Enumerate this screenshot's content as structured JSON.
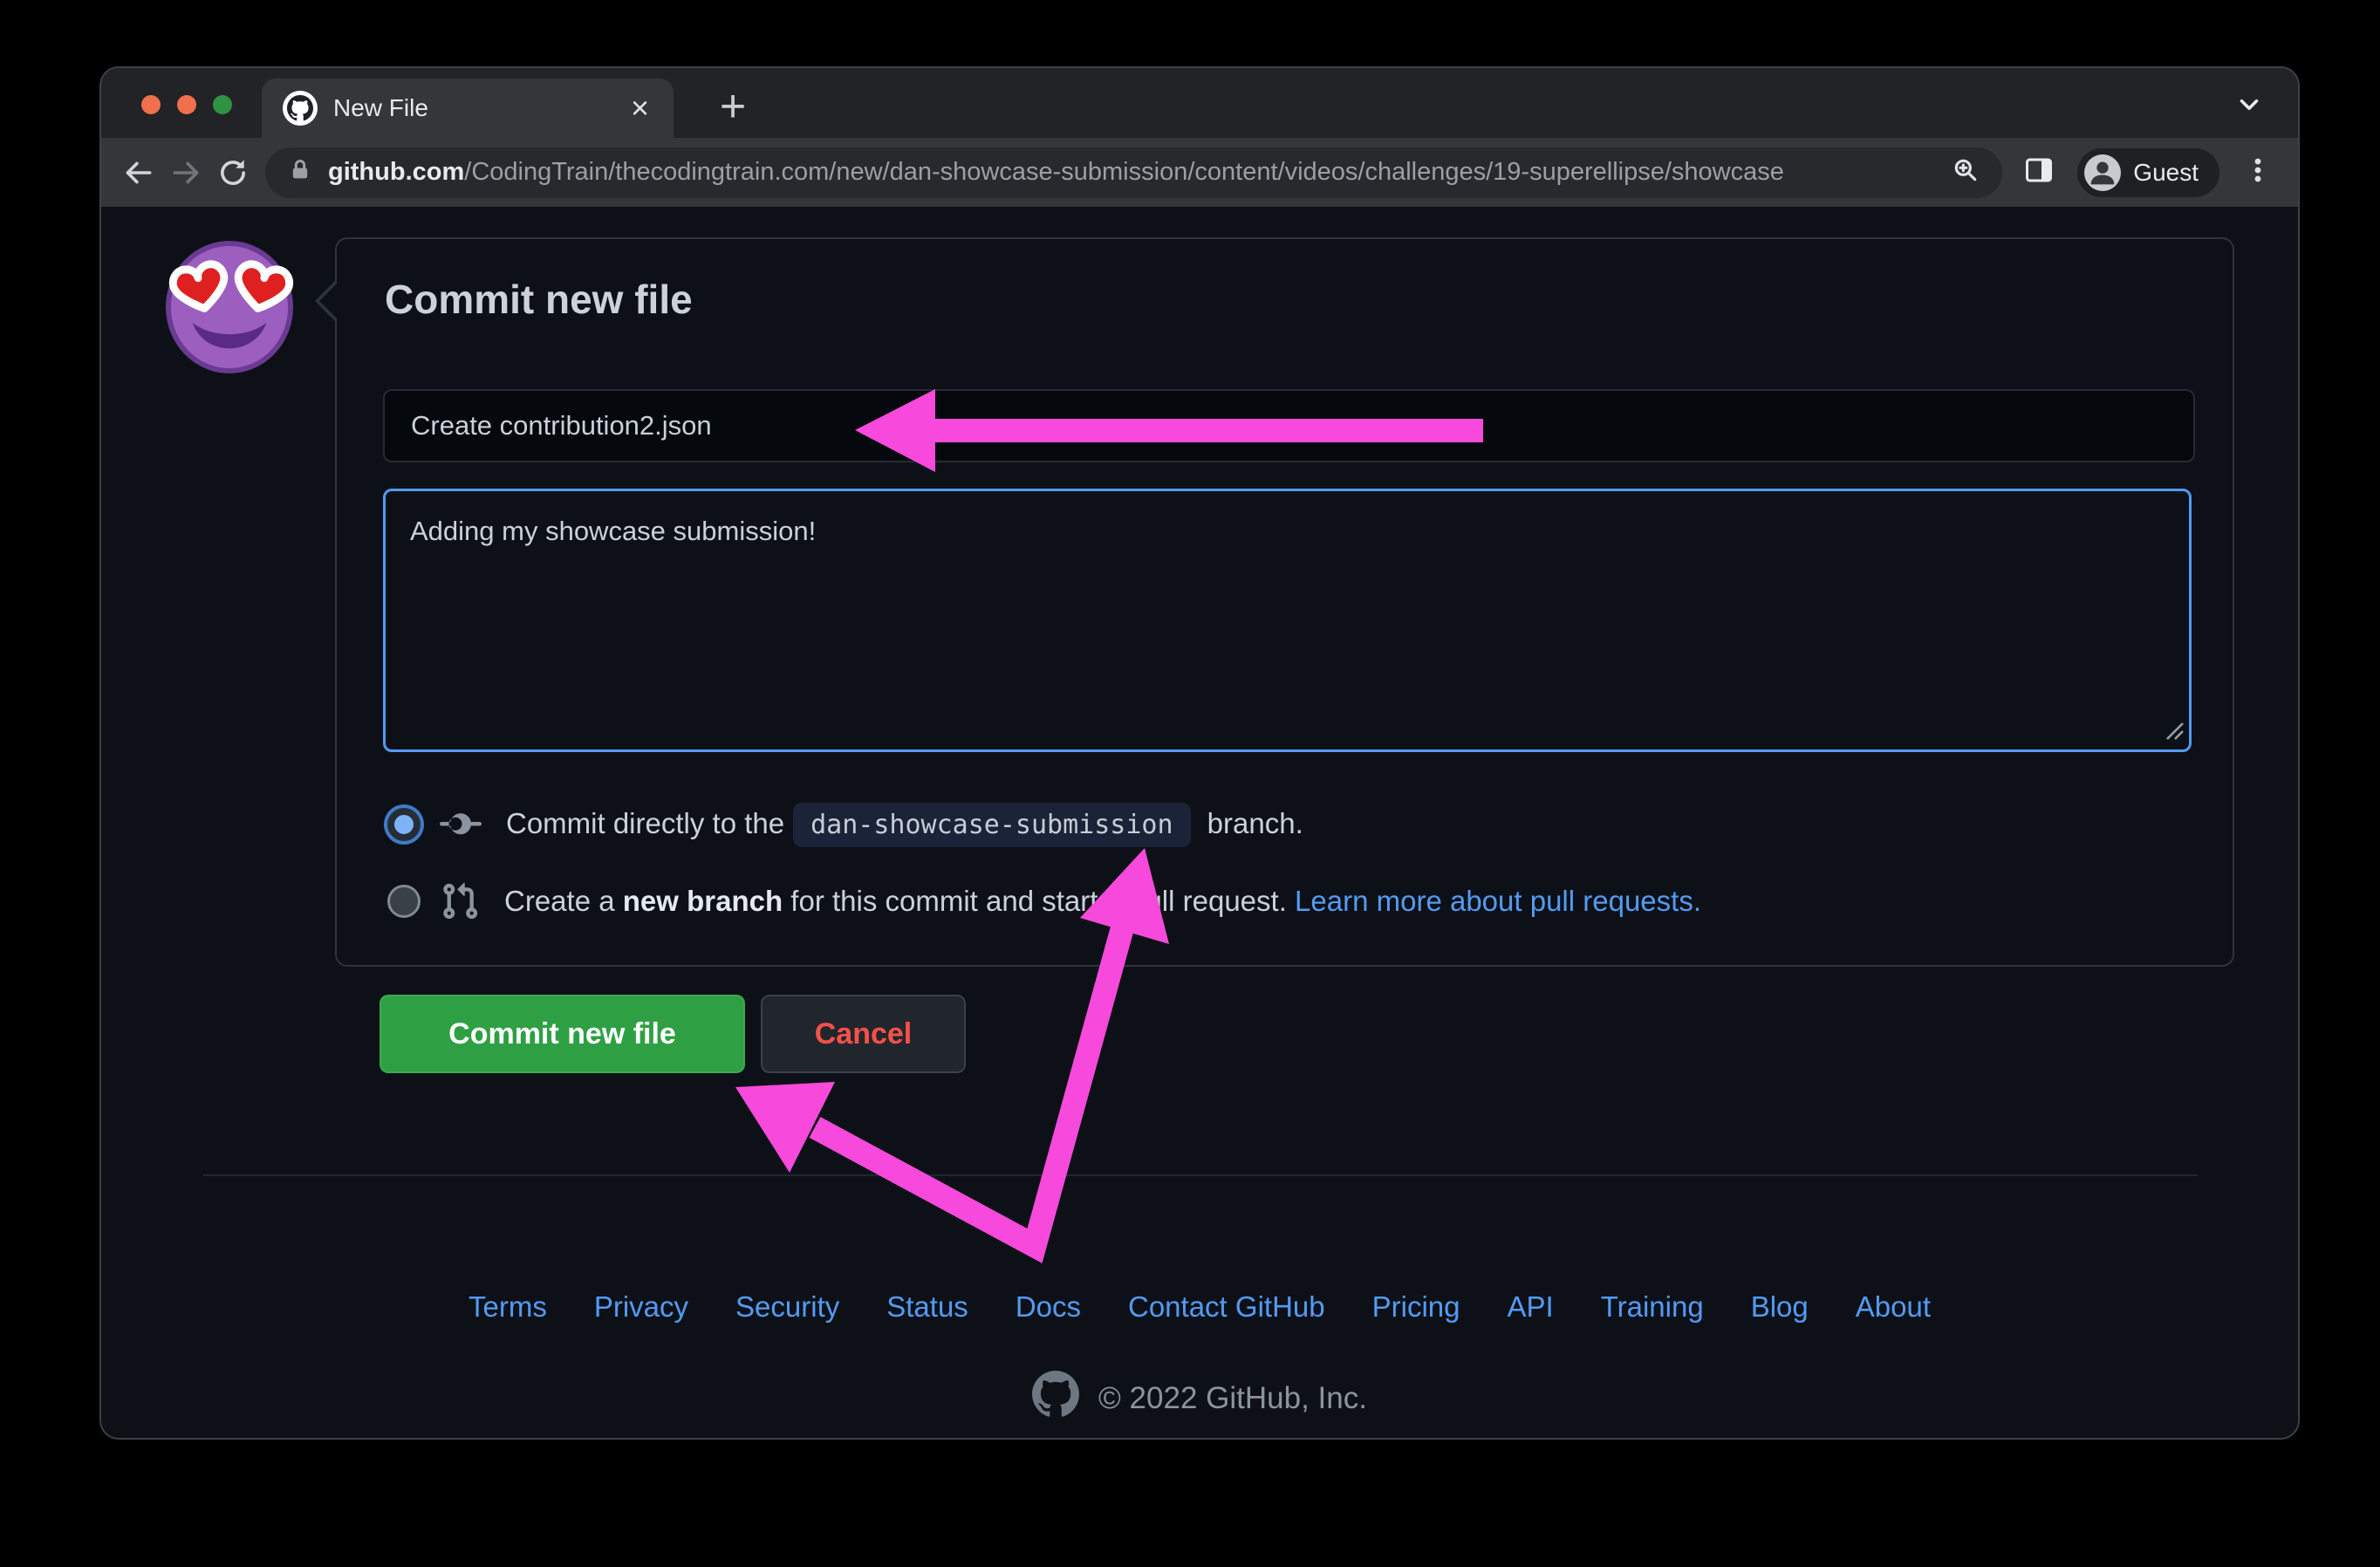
{
  "browser": {
    "tab": {
      "title": "New File",
      "close_glyph": "×"
    },
    "new_tab_glyph": "+",
    "url": {
      "domain": "github.com",
      "path": "/CodingTrain/thecodingtrain.com/new/dan-showcase-submission/content/videos/challenges/19-superellipse/showcase"
    },
    "guest_label": "Guest"
  },
  "commit_form": {
    "heading": "Commit new file",
    "title_input": {
      "value": "Create contribution2.json"
    },
    "description_input": {
      "value": "Adding my showcase submission!"
    },
    "radio_direct": {
      "selected": true,
      "text_before": "Commit directly to the",
      "branch_name": "dan-showcase-submission",
      "text_after": " branch."
    },
    "radio_new_branch": {
      "selected": false,
      "text_before": "Create a ",
      "bold_text": "new branch",
      "text_after": " for this commit and start a pull request. ",
      "link_text": "Learn more about pull requests."
    },
    "commit_button_label": "Commit new file",
    "cancel_button_label": "Cancel"
  },
  "footer": {
    "links": [
      "Terms",
      "Privacy",
      "Security",
      "Status",
      "Docs",
      "Contact GitHub",
      "Pricing",
      "API",
      "Training",
      "Blog",
      "About"
    ],
    "copyright": "© 2022 GitHub, Inc."
  },
  "colors": {
    "arrow_pink": "#f74adc",
    "commit_green": "#2ea043",
    "link_blue": "#539bf5",
    "cancel_red": "#f85149",
    "focus_blue": "#539bf5"
  }
}
